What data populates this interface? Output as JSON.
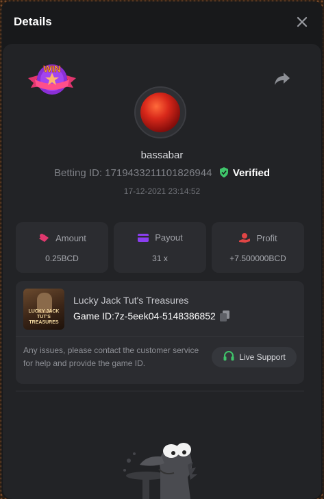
{
  "header": {
    "title": "Details"
  },
  "icons": {
    "close": "close-icon",
    "share": "share-icon",
    "win": "win-badge-icon",
    "verified": "shield-check-icon",
    "amount": "bet-icon",
    "payout": "card-icon",
    "profit": "profit-hand-icon",
    "copy": "copy-icon",
    "support": "headset-icon"
  },
  "badge": {
    "text": "WIN"
  },
  "user": {
    "name": "bassabar",
    "betting_id_label": "Betting ID: 1719433211101826944",
    "verified_label": "Verified",
    "timestamp": "17-12-2021 23:14:52"
  },
  "stats": [
    {
      "label": "Amount",
      "value": "0.25BCD",
      "color": "#e0386e"
    },
    {
      "label": "Payout",
      "value": "31 x",
      "color": "#8b3ef0"
    },
    {
      "label": "Profit",
      "value": "+7.500000BCD",
      "color": "#e04545"
    }
  ],
  "game": {
    "name": "Lucky Jack Tut's Treasures",
    "id_label": "Game ID:7z-5eek04-5148386852",
    "thumb_text": "LUCKY JACK TUT'S TREASURES"
  },
  "support": {
    "message": "Any issues, please contact the customer service for help and provide the game ID.",
    "button_label": "Live Support"
  },
  "colors": {
    "accent_green": "#3fc46a",
    "modal_bg": "#18191b",
    "panel_bg": "#222326",
    "card_bg": "#2b2c30"
  }
}
